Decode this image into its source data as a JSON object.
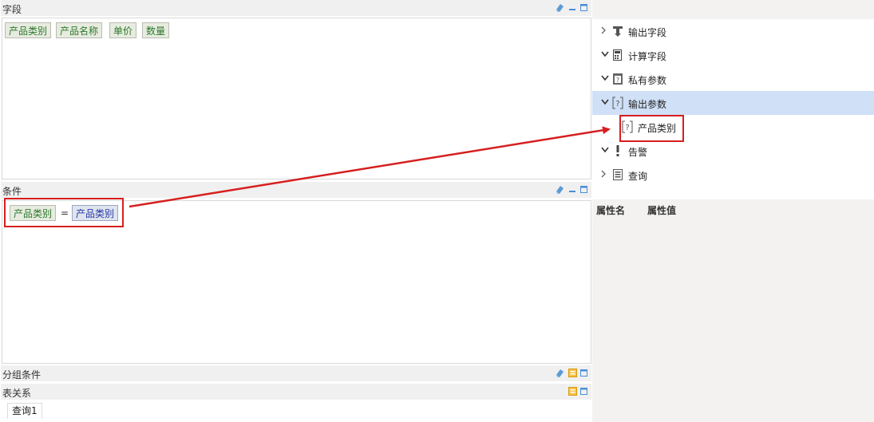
{
  "fields_panel": {
    "title": "字段",
    "chips": [
      "产品类别",
      "产品名称",
      "单价",
      "数量"
    ]
  },
  "condition_panel": {
    "title": "条件",
    "left": "产品类别",
    "operator": "=",
    "right": "产品类别"
  },
  "group_panel": {
    "title": "分组条件"
  },
  "relation_panel": {
    "title": "表关系",
    "tab": "查询1"
  },
  "tree": {
    "items": [
      {
        "label": "输出字段",
        "icon": "output-field-icon",
        "expanded": false
      },
      {
        "label": "计算字段",
        "icon": "calculator-icon",
        "expanded": true
      },
      {
        "label": "私有参数",
        "icon": "private-param-icon",
        "expanded": true
      },
      {
        "label": "输出参数",
        "icon": "output-param-icon",
        "expanded": true,
        "selected": true
      },
      {
        "label": "产品类别",
        "icon": "param-icon",
        "child": true
      },
      {
        "label": "告警",
        "icon": "alert-icon",
        "expanded": true
      },
      {
        "label": "查询",
        "icon": "query-icon",
        "expanded": false
      }
    ]
  },
  "properties": {
    "col_name": "属性名",
    "col_value": "属性值"
  },
  "colors": {
    "highlight": "#d61f1f",
    "selected_row": "#cfe0f7",
    "chip_text": "#2b7a2b",
    "param_chip_text": "#2637a8"
  }
}
